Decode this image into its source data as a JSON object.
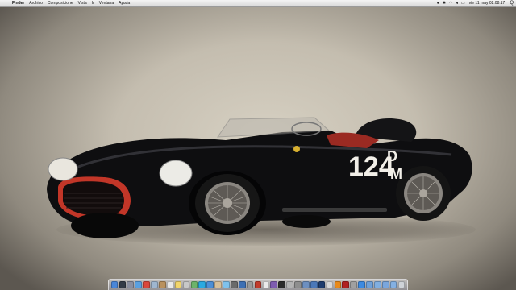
{
  "menubar": {
    "apple_glyph": "",
    "app_name": "Finder",
    "menus": [
      "Archivo",
      "Composicione",
      "Vista",
      "Ir",
      "Ventana",
      "Ayuda"
    ],
    "clock": "vie 11 may 02:08:17",
    "spotlight_glyph": "Q"
  },
  "car": {
    "race_number": "124",
    "letters_top": "D",
    "letters_bottom": "M"
  },
  "dock": {
    "icons": [
      {
        "name": "finder-icon",
        "color": "#4a86d8"
      },
      {
        "name": "dashboard-icon",
        "color": "#333b47"
      },
      {
        "name": "launchpad-icon",
        "color": "#8a8fa0"
      },
      {
        "name": "safari-icon",
        "color": "#5aa0e0"
      },
      {
        "name": "chrome-icon",
        "color": "#d9473b"
      },
      {
        "name": "mail-icon",
        "color": "#9fb6cf"
      },
      {
        "name": "contacts-icon",
        "color": "#b9915e"
      },
      {
        "name": "calendar-icon",
        "color": "#e8e8e8"
      },
      {
        "name": "notes-icon",
        "color": "#f2d56a"
      },
      {
        "name": "ical-icon",
        "color": "#c8c8c8"
      },
      {
        "name": "maps-icon",
        "color": "#6db36a"
      },
      {
        "name": "skype-icon",
        "color": "#2aa9e0"
      },
      {
        "name": "itunes-icon",
        "color": "#4c8fd6"
      },
      {
        "name": "photos-icon",
        "color": "#d7c09a"
      },
      {
        "name": "messages-icon",
        "color": "#7fc2ec"
      },
      {
        "name": "facetime-icon",
        "color": "#6a6a6a"
      },
      {
        "name": "iphoto-icon",
        "color": "#3d6fb4"
      },
      {
        "name": "imovie-icon",
        "color": "#9a9a9a"
      },
      {
        "name": "flash-icon",
        "color": "#c23b2c"
      },
      {
        "name": "textedit-icon",
        "color": "#eaeaea"
      },
      {
        "name": "istat-icon",
        "color": "#7e5cb0"
      },
      {
        "name": "terminal-icon",
        "color": "#2b2b2b"
      },
      {
        "name": "keychain-icon",
        "color": "#b3b3b3"
      },
      {
        "name": "system-preferences-icon",
        "color": "#8e8e8e"
      },
      {
        "name": "preview-icon",
        "color": "#6d8fbf"
      },
      {
        "name": "xcode-icon",
        "color": "#4b78b8"
      },
      {
        "name": "photoshop-icon",
        "color": "#1e3c6e"
      },
      {
        "name": "utilities-icon",
        "color": "#d8d8d8"
      },
      {
        "name": "vlc-icon",
        "color": "#e88a1a"
      },
      {
        "name": "transmission-icon",
        "color": "#b02020"
      },
      {
        "name": "disk-utility-icon",
        "color": "#a0a0a0"
      },
      {
        "name": "app-store-icon",
        "color": "#3d8ae0"
      },
      {
        "name": "home-folder-icon",
        "color": "#6fa0d8"
      },
      {
        "name": "applications-folder-icon",
        "color": "#80aee0"
      },
      {
        "name": "downloads-folder-icon",
        "color": "#7aa6dc"
      },
      {
        "name": "documents-folder-icon",
        "color": "#84b0e2"
      },
      {
        "name": "trash-icon",
        "color": "#cfd3d8"
      }
    ]
  }
}
